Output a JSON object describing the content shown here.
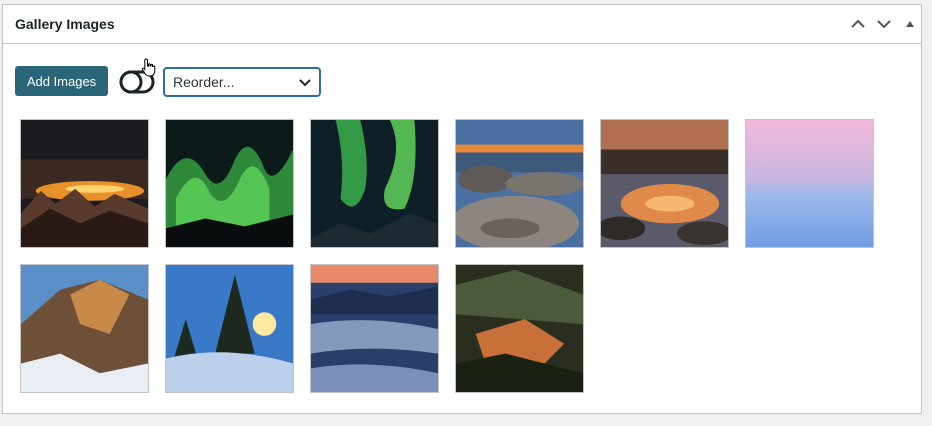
{
  "metabox": {
    "title": "Gallery Images",
    "move_up_icon": "chevron-up-icon",
    "move_down_icon": "chevron-down-icon",
    "toggle_icon": "triangle-up-icon"
  },
  "toolbar": {
    "add_images_label": "Add Images",
    "toggle_icon": "toggle-switch-icon",
    "reorder_selected": "Reorder..."
  },
  "gallery": {
    "images": [
      {
        "name": "mountain-sunset-silhouette"
      },
      {
        "name": "green-aurora"
      },
      {
        "name": "green-aurora-mountains"
      },
      {
        "name": "rocky-shore-sunset"
      },
      {
        "name": "river-sunset-reflection"
      },
      {
        "name": "pink-blue-sky"
      },
      {
        "name": "snowy-mountain-ridge"
      },
      {
        "name": "snowy-pine-tree"
      },
      {
        "name": "foggy-mountain-valley"
      },
      {
        "name": "forested-hills"
      }
    ]
  }
}
